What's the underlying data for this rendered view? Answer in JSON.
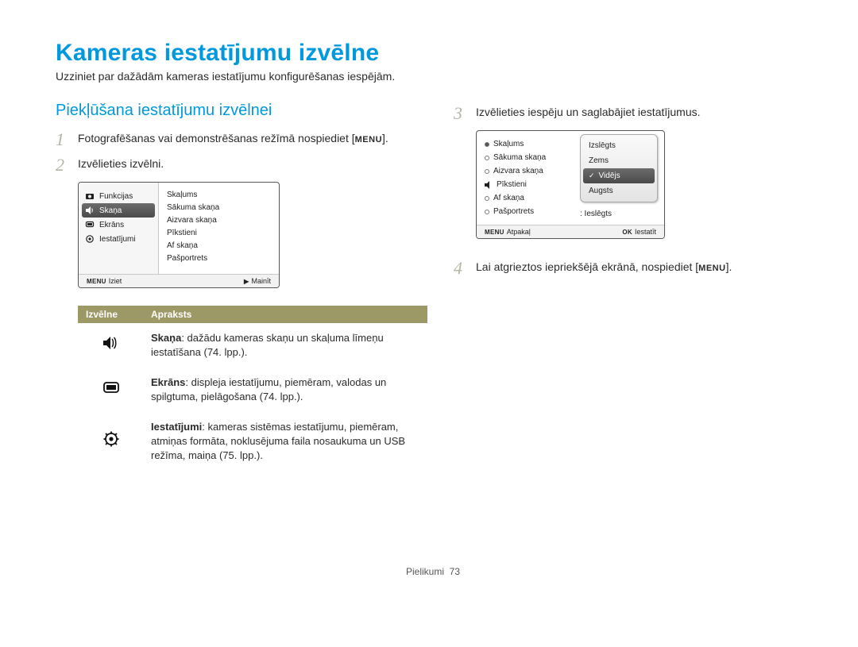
{
  "page": {
    "title": "Kameras iestatījumu izvēlne",
    "intro": "Uzziniet par dažādām kameras iestatījumu konfigurēšanas iespējām.",
    "footer_label": "Pielikumi",
    "footer_page": "73"
  },
  "left": {
    "heading": "Piekļūšana iestatījumu izvēlnei",
    "step1_a": "Fotografēšanas vai demonstrēšanas režīmā nospiediet [",
    "step1_b": "].",
    "step2": "Izvēlieties izvēlni.",
    "menu_key": "MENU"
  },
  "cam1": {
    "left_items": [
      {
        "icon": "camera",
        "label": "Funkcijas"
      },
      {
        "icon": "sound",
        "label": "Skaņa"
      },
      {
        "icon": "screen",
        "label": "Ekrāns"
      },
      {
        "icon": "gear",
        "label": "Iestatījumi"
      }
    ],
    "selected_index": 1,
    "right_items": [
      "Skaļums",
      "Sākuma skaņa",
      "Aizvara skaņa",
      "Pīkstieni",
      "Af skaņa",
      "Pašportrets"
    ],
    "foot_left_key": "MENU",
    "foot_left": "Iziet",
    "foot_right_key": "▶",
    "foot_right": "Mainīt"
  },
  "desc_table": {
    "head_a": "Izvēlne",
    "head_b": "Apraksts",
    "rows": [
      {
        "icon": "sound",
        "bold": "Skaņa",
        "text": ": dažādu kameras skaņu un skaļuma līmeņu iestatīšana (74. lpp.)."
      },
      {
        "icon": "screen",
        "bold": "Ekrāns",
        "text": ": displeja iestatījumu, piemēram, valodas un spilgtuma, pielāgošana (74. lpp.)."
      },
      {
        "icon": "gear",
        "bold": "Iestatījumi",
        "text": ": kameras sistēmas iestatījumu, piemēram, atmiņas formāta, noklusējuma faila nosaukuma un USB režīma, maiņa (75. lpp.)."
      }
    ]
  },
  "right": {
    "step3": "Izvēlieties iespēju un saglabājiet iestatījumus.",
    "step4_a": "Lai atgrieztos iepriekšējā ekrānā, nospiediet [",
    "step4_b": "].",
    "menu_key": "MENU"
  },
  "cam2": {
    "items": [
      {
        "label": "Skaļums",
        "filled": true
      },
      {
        "label": "Sākuma skaņa",
        "filled": false
      },
      {
        "label": "Aizvara skaņa",
        "filled": false
      },
      {
        "label": "Pīkstieni",
        "icon": "sound"
      },
      {
        "label": "Af skaņa",
        "filled": false
      },
      {
        "label": "Pašportrets",
        "filled": false
      }
    ],
    "last_value": ": Ieslēgts",
    "popup": {
      "options": [
        "Izslēgts",
        "Zems",
        "Vidējs",
        "Augsts"
      ],
      "selected_index": 2
    },
    "foot_left_key": "MENU",
    "foot_left": "Atpakaļ",
    "foot_right_key": "OK",
    "foot_right": "Iestatīt"
  }
}
